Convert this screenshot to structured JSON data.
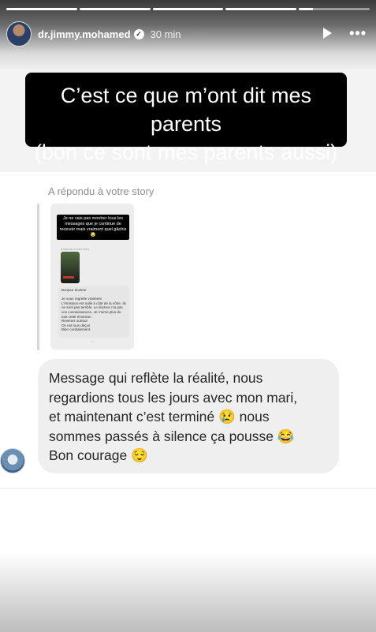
{
  "story": {
    "progress_segments": [
      1,
      1,
      1,
      1,
      0.2
    ],
    "username": "dr.jimmy.mohamed",
    "verified_badge_icon": "verified-icon",
    "time": "30 min",
    "caption_line1": "C’est ce que m’ont dit mes parents",
    "caption_line2": "(bon ce sont mes parents aussi)"
  },
  "reply": {
    "replied_label": "A répondu à votre story",
    "thumbnail": {
      "caption": "Je ne vais pas montrer tous les messages que je continue de recevoir mais vraiment quel gâchis 😓",
      "small_label": "A répondu à votre story",
      "message": "Bonjour docteur\n\nJe vous regrette vraiment\nL'émission est nulle à côté de la vôtre. Ils ne sont pas terrible. Le docteur n'a pas vos connaissances. Je n'aime plus du tout cette émission\nRevenez surtout\nOn est tous déçus\nBien cordialement."
    },
    "message_lines": [
      "Message qui reflète la réalité, nous",
      "regardions tous les jours avec mon mari,",
      "et maintenant c’est terminé 😢 nous",
      "sommes passés à silence ça pousse 😂",
      "Bon courage 😌"
    ]
  },
  "colors": {
    "caption_bg": "#000000",
    "bubble_bg": "#efefef",
    "muted_text": "#8e8e8e"
  }
}
